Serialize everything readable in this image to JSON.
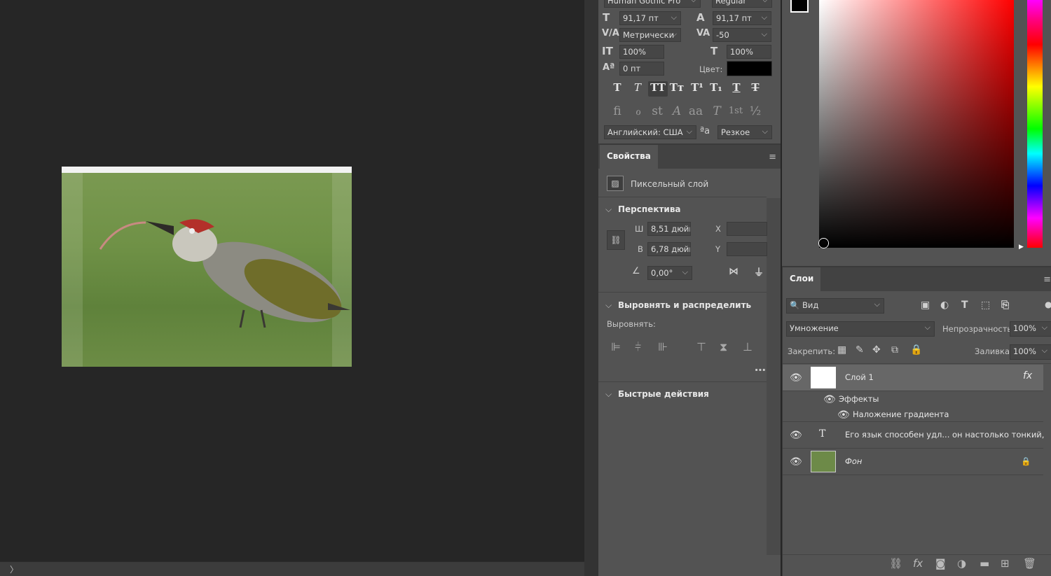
{
  "character": {
    "font_family": "Human Gothic Pro",
    "font_style": "Regular",
    "font_size": "91,17 пт",
    "leading": "91,17 пт",
    "kerning": "Метрически",
    "tracking": "-50",
    "vertical_scale": "100%",
    "horizontal_scale": "100%",
    "baseline_shift": "0 пт",
    "color_label": "Цвет:",
    "language": "Английский: США",
    "antialias": "Резкое",
    "type_styles": [
      "T",
      "T",
      "TT",
      "Tт",
      "T¹",
      "T₁",
      "T",
      "T"
    ],
    "opentype": [
      "fi",
      "ℴ",
      "st",
      "A",
      "aa",
      "T",
      "1st",
      "½"
    ],
    "aa_glyph": "ªa"
  },
  "properties": {
    "tab": "Свойства",
    "layer_type": "Пиксельный слой",
    "section_transform": "Перспектива",
    "w_label": "Ш",
    "w_value": "8,51 дюйм",
    "h_label": "В",
    "h_value": "6,78 дюйм",
    "x_label": "X",
    "y_label": "Y",
    "angle_value": "0,00°",
    "section_align": "Выровнять и распределить",
    "align_label": "Выровнять:",
    "section_quick": "Быстрые действия"
  },
  "layers": {
    "tab": "Слои",
    "filter_kind": "Вид",
    "blend_mode": "Умножение",
    "opacity_label": "Непрозрачность:",
    "opacity_value": "100%",
    "lock_label": "Закрепить:",
    "fill_label": "Заливка:",
    "fill_value": "100%",
    "layer1_name": "Слой 1",
    "fx_badge": "fx",
    "effects_label": "Эффекты",
    "effect_name": "Наложение градиента",
    "text_layer_name": "Его язык способен удл... он настолько тонкий,",
    "text_layer_glyph": "T",
    "bg_layer_name": "Фон"
  },
  "colors": {
    "panel_bg": "#535353",
    "canvas_bg": "#262626",
    "fg_swatch": "#000000"
  },
  "status": {
    "expand_glyph": "〉"
  }
}
